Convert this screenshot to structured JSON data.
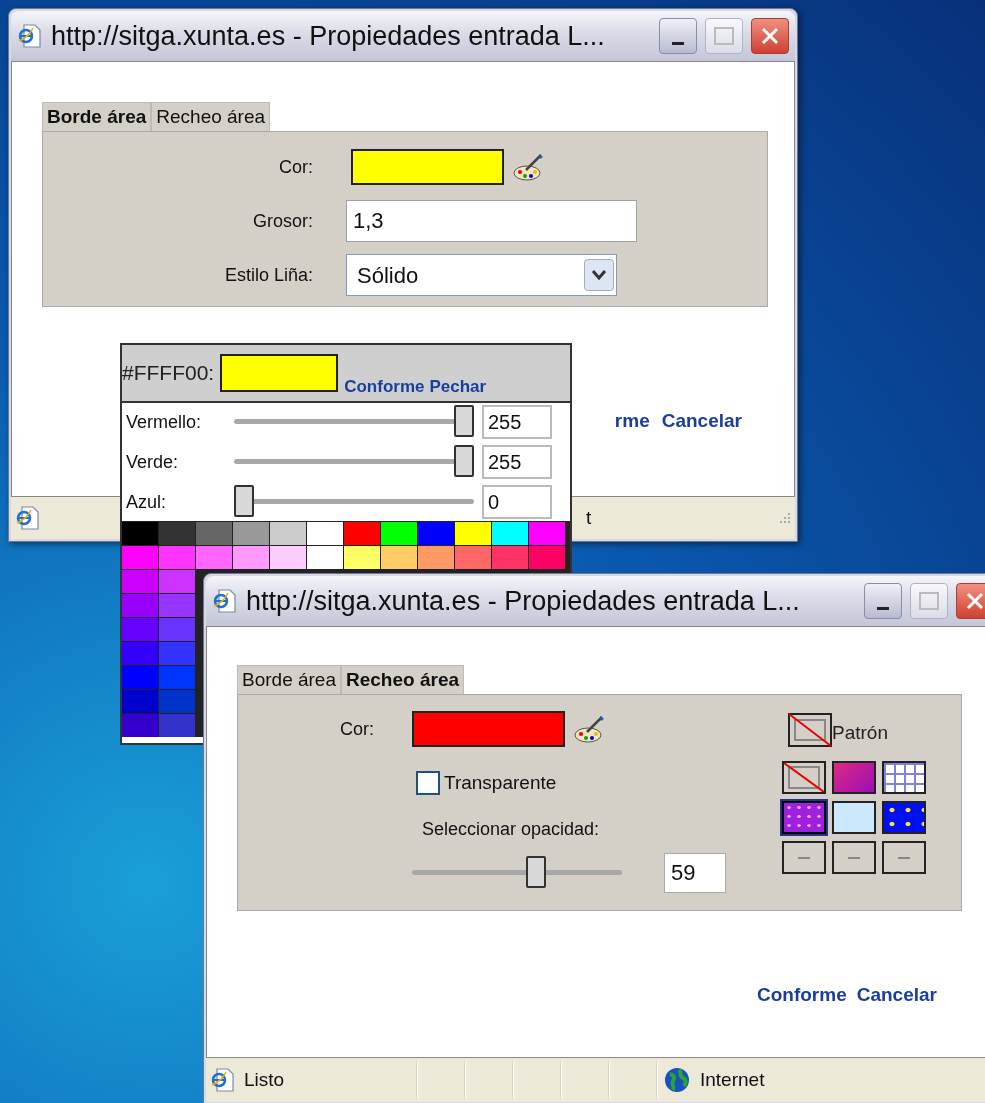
{
  "back_window": {
    "title": "http://sitga.xunta.es - Propiedades entrada L...",
    "tabs": [
      {
        "label": "Borde área",
        "selected": true
      },
      {
        "label": "Recheo área",
        "selected": false
      }
    ],
    "fields": [
      {
        "kind": "color",
        "label": "Cor:",
        "color": "#ffff00"
      },
      {
        "kind": "text",
        "label": "Grosor:",
        "value": "1,3"
      },
      {
        "kind": "select",
        "label": "Estilo Liña:",
        "value": "Sólido"
      }
    ],
    "actions": [
      "rme",
      "Cancelar"
    ],
    "status": "t"
  },
  "color_picker": {
    "hex": "#FFFF00:",
    "color": "#ffff00",
    "actions": [
      "Conforme",
      "Pechar"
    ],
    "channels": [
      {
        "label": "Vermello:",
        "level": 1,
        "value": "255"
      },
      {
        "label": "Verde:",
        "level": 1,
        "value": "255"
      },
      {
        "label": "Azul:",
        "level": 0,
        "value": "0"
      }
    ],
    "palette": [
      [
        {
          "color": "#000000"
        },
        {
          "color": "#333333"
        },
        {
          "color": "#666666"
        },
        {
          "color": "#999999"
        },
        {
          "color": "#cccccc"
        },
        {
          "color": "#ffffff"
        },
        {
          "color": "#ff0000"
        },
        {
          "color": "#00ff00"
        },
        {
          "color": "#0000ff"
        },
        {
          "color": "#ffff00"
        },
        {
          "color": "#00ffff"
        },
        {
          "color": "#ff00ff"
        }
      ],
      [
        {
          "color": "#ff00ff"
        },
        {
          "color": "#ff33ff"
        },
        {
          "color": "#ff66ff"
        },
        {
          "color": "#ff99ff"
        },
        {
          "color": "#ffccff"
        },
        {
          "color": "#ffffff"
        },
        {
          "color": "#ffff66"
        },
        {
          "color": "#ffcc66"
        },
        {
          "color": "#ff9966"
        },
        {
          "color": "#ff6666"
        },
        {
          "color": "#ff3366"
        },
        {
          "color": "#ff0066"
        }
      ],
      [
        {
          "color": "#cc00ff"
        },
        {
          "color": "#cc33ff"
        }
      ],
      [
        {
          "color": "#9900ff"
        },
        {
          "color": "#9933ff"
        }
      ],
      [
        {
          "color": "#6600ff"
        },
        {
          "color": "#6633ff"
        }
      ],
      [
        {
          "color": "#3300ff"
        },
        {
          "color": "#3333ff"
        }
      ],
      [
        {
          "color": "#0000ff"
        },
        {
          "color": "#0033ff"
        }
      ],
      [
        {
          "color": "#0000cc"
        },
        {
          "color": "#0033cc"
        }
      ],
      [
        {
          "color": "#3300cc"
        },
        {
          "color": "#3333cc"
        }
      ]
    ]
  },
  "front_window": {
    "title": "http://sitga.xunta.es - Propiedades entrada L...",
    "tabs": [
      {
        "label": "Borde área",
        "selected": false
      },
      {
        "label": "Recheo área",
        "selected": true
      }
    ],
    "color_label": "Cor:",
    "color": "#ff0000",
    "transparent": {
      "label": "Transparente",
      "checked": false
    },
    "opacity": {
      "label": "Seleccionar opacidad:",
      "level": 0.6,
      "value": "59"
    },
    "pattern_label": "Patrón",
    "patterns": [
      {
        "kind": "none",
        "selected": false
      },
      {
        "kind": "gradient",
        "selected": false
      },
      {
        "kind": "grid",
        "selected": false
      },
      {
        "kind": "sparkle",
        "selected": true
      },
      {
        "kind": "plain",
        "selected": false
      },
      {
        "kind": "stars",
        "selected": false
      },
      {
        "kind": "empty",
        "selected": false
      },
      {
        "kind": "empty",
        "selected": false
      },
      {
        "kind": "empty",
        "selected": false
      }
    ],
    "actions": [
      "Conforme",
      "Cancelar"
    ],
    "status": {
      "text": "Listo",
      "zone": "Internet"
    }
  }
}
